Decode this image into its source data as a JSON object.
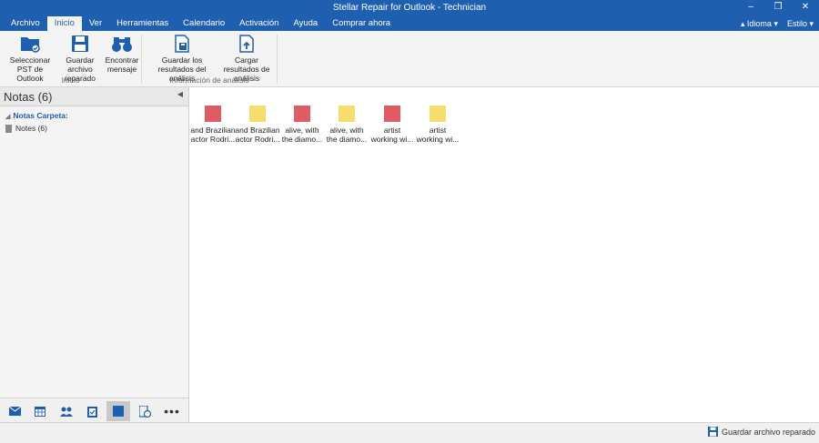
{
  "window": {
    "title": "Stellar Repair for Outlook - Technician"
  },
  "menu": {
    "tabs": [
      "Archivo",
      "Inicio",
      "Ver",
      "Herramientas",
      "Calendario",
      "Activación",
      "Ayuda",
      "Comprar ahora"
    ],
    "active_tab": "Inicio",
    "idioma": "Idioma",
    "estilo": "Estilo"
  },
  "ribbon": {
    "select_pst": "Seleccionar PST de Outlook",
    "save_repaired": "Guardar archivo reparado",
    "find_message": "Encontrar mensaje",
    "group_inicio": "Inicio",
    "save_scan": "Guardar los resultados del análisis",
    "load_scan": "Cargar resultados de análisis",
    "group_analysis": "Información de análisis"
  },
  "leftpane": {
    "header": "Notas (6)",
    "root": "Notas Carpeta:",
    "item": "Notes (6)"
  },
  "notes": [
    {
      "label1": "and Brazilian",
      "label2": "actor Rodri...",
      "color": "#e05c65"
    },
    {
      "label1": "and Brazilian",
      "label2": "actor Rodri...",
      "color": "#f5dd6e"
    },
    {
      "label1": "alive, with",
      "label2": "the diamo...",
      "color": "#e05c65"
    },
    {
      "label1": "alive, with",
      "label2": "the diamo...",
      "color": "#f5dd6e"
    },
    {
      "label1": "artist",
      "label2": "working wi...",
      "color": "#e05c65"
    },
    {
      "label1": "artist",
      "label2": "working wi...",
      "color": "#f5dd6e"
    }
  ],
  "statusbar": {
    "save": "Guardar archivo reparado"
  },
  "colors": {
    "accent": "#1f5fb0",
    "note_red": "#e05c65",
    "note_yellow": "#f5dd6e"
  }
}
